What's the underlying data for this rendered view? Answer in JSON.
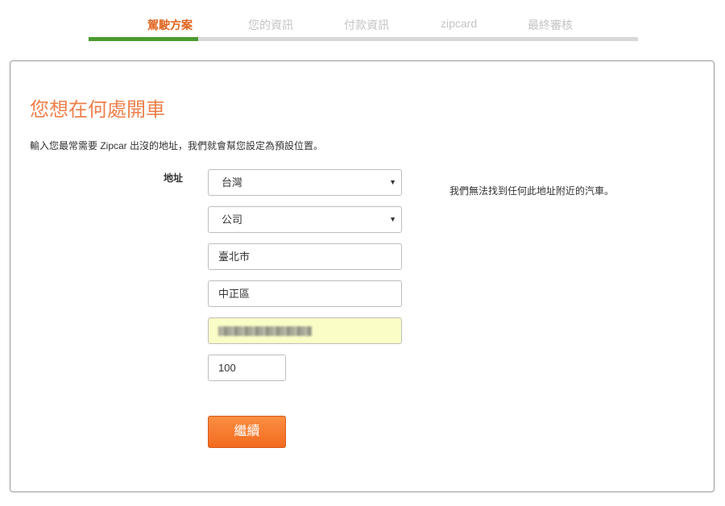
{
  "steps": [
    {
      "label": "駕駛方案",
      "active": true
    },
    {
      "label": "您的資訊",
      "active": false
    },
    {
      "label": "付款資訊",
      "active": false
    },
    {
      "label": "zipcard",
      "active": false
    },
    {
      "label": "最終審核",
      "active": false
    }
  ],
  "progress": {
    "completed_steps": 1,
    "total_steps": 5
  },
  "colors": {
    "active_step": "#e0631e",
    "inactive_step": "#c4c4c4",
    "progress_fill": "#4a9a2f",
    "heading": "#ef7f4a",
    "button": "#f26b1f",
    "autofill_highlight": "#fafdc6"
  },
  "form": {
    "heading": "您想在何處開車",
    "intro": "輸入您最常需要 Zipcar 出沒的地址，我們就會幫您設定為預設位置。",
    "address_label": "地址",
    "country": {
      "value": "台灣",
      "icon": "caret-down-icon"
    },
    "address_type": {
      "value": "公司",
      "icon": "caret-down-icon"
    },
    "city": {
      "value": "臺北市"
    },
    "district": {
      "value": "中正區"
    },
    "street": {
      "value": ""
    },
    "postal_code": {
      "value": "100"
    },
    "continue_label": "繼續"
  },
  "notice": "我們無法找到任何此地址附近的汽車。"
}
